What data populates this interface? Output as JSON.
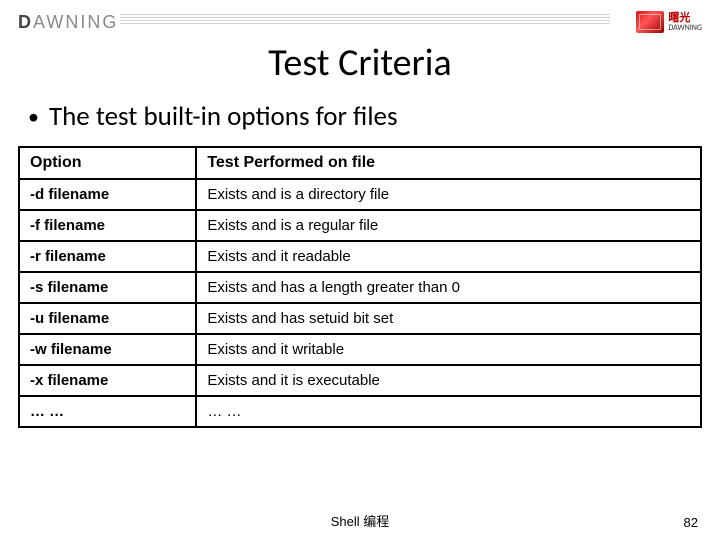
{
  "header": {
    "brand_left_html": "DAWNING",
    "brand_right_cn": "曙光",
    "brand_right_sub": "DAWNING"
  },
  "title": "Test Criteria",
  "bullet": "The test built-in options for files",
  "table": {
    "headers": [
      "Option",
      "Test Performed on file"
    ],
    "rows": [
      [
        "-d filename",
        "Exists and is a directory file"
      ],
      [
        "-f filename",
        "Exists and is a regular file"
      ],
      [
        "-r filename",
        "Exists and it readable"
      ],
      [
        "-s filename",
        "Exists and has a length greater than 0"
      ],
      [
        "-u filename",
        "Exists and has setuid bit set"
      ],
      [
        "-w filename",
        "Exists and it writable"
      ],
      [
        "-x filename",
        "Exists and it is executable"
      ],
      [
        "… …",
        "… …"
      ]
    ]
  },
  "footer": "Shell 编程",
  "page_number": "82"
}
